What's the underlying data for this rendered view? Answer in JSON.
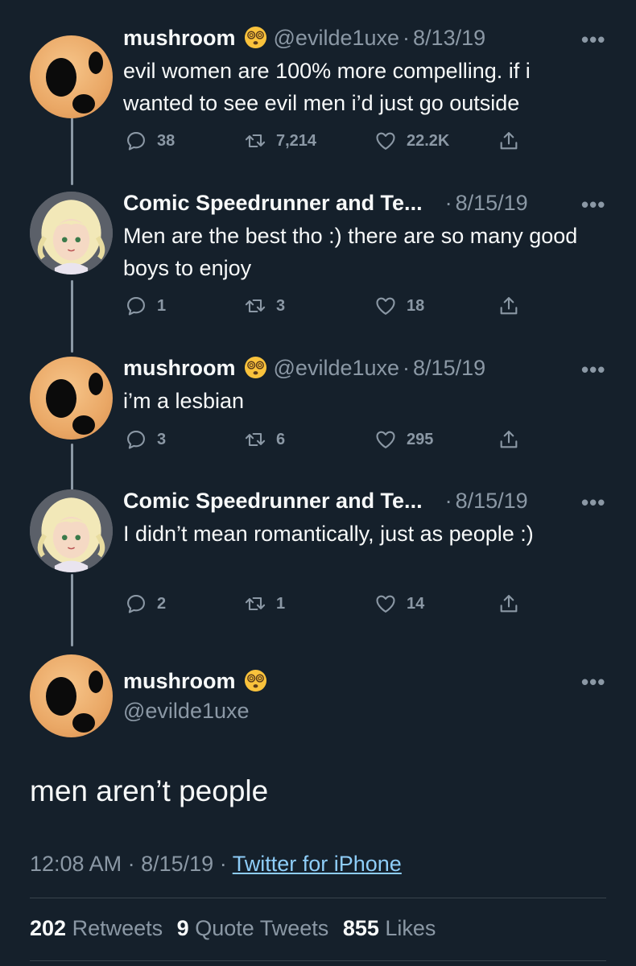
{
  "tweets": [
    {
      "name": "mushroom",
      "handle": "@evilde1uxe",
      "date": "8/13/19",
      "text": "evil women are 100% more compelling. if i wanted to see evil men i’d just go outside",
      "replies": "38",
      "retweets": "7,214",
      "likes": "22.2K"
    },
    {
      "name": "Comic Speedrunner and Te...",
      "date": "8/15/19",
      "text": "Men are the best tho :) there are so many good boys to enjoy",
      "replies": "1",
      "retweets": "3",
      "likes": "18"
    },
    {
      "name": "mushroom",
      "handle": "@evilde1uxe",
      "date": "8/15/19",
      "text": "i’m a lesbian",
      "replies": "3",
      "retweets": "6",
      "likes": "295"
    },
    {
      "name": "Comic Speedrunner and Te...",
      "date": "8/15/19",
      "text": "I didn’t mean romantically, just as people :)",
      "replies": "2",
      "retweets": "1",
      "likes": "14"
    }
  ],
  "main_tweet": {
    "name": "mushroom",
    "handle": "@evilde1uxe",
    "text": "men aren’t people",
    "time": "12:08 AM",
    "date": "8/15/19",
    "source": "Twitter for iPhone",
    "retweets_count": "202",
    "retweets_label": "Retweets",
    "quotes_count": "9",
    "quotes_label": "Quote Tweets",
    "likes_count": "855",
    "likes_label": "Likes"
  },
  "icons": {
    "reply": "reply-icon",
    "retweet": "retweet-icon",
    "like": "heart-icon",
    "share": "share-icon",
    "more": "more-icon",
    "emoji": "dizzy-face-emoji"
  },
  "colors": {
    "background": "#15202b",
    "text": "#f7f9f9",
    "muted": "#8b98a5",
    "link": "#8ecdf8",
    "divider": "#38444d"
  },
  "separator": "·",
  "more_glyph": "•••"
}
